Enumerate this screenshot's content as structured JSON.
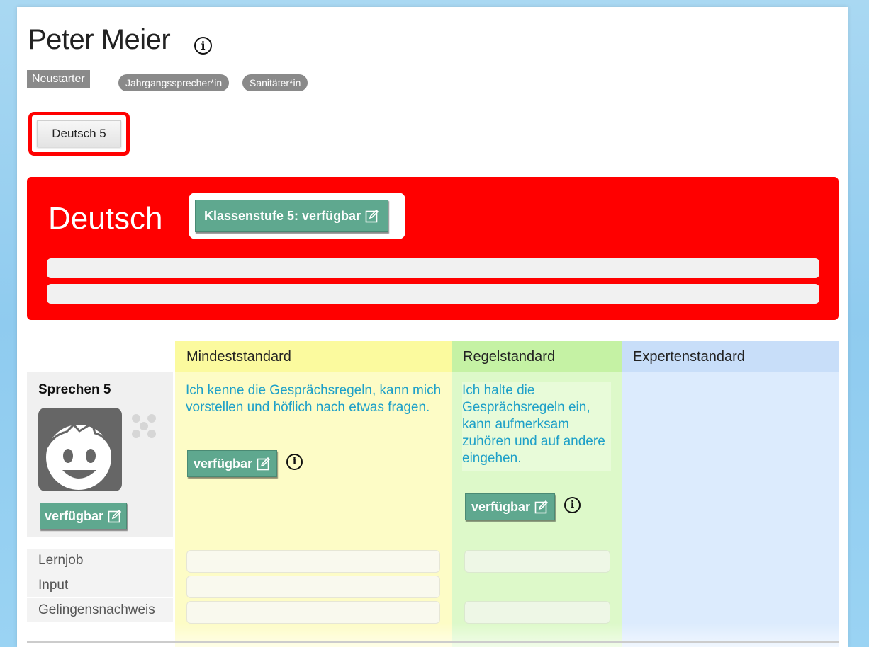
{
  "student": {
    "name": "Peter Meier",
    "status_badge": "Neustarter",
    "roles": [
      "Jahrgangssprecher*in",
      "Sanitäter*in"
    ]
  },
  "subject_tab": {
    "label": "Deutsch 5"
  },
  "subject_panel": {
    "title": "Deutsch",
    "level_button": "Klassenstufe 5: verfügbar",
    "color": "#ff0000"
  },
  "standards": {
    "headers": [
      "Mindeststandard",
      "Regelstandard",
      "Expertenstandard"
    ],
    "colors": {
      "min": "#fbfa9e",
      "regel": "#c5f2a4",
      "experten": "#c8def9"
    }
  },
  "competence": {
    "title": "Sprechen 5",
    "button": "verfügbar",
    "min_description": "Ich kenne die Gesprächsregeln, kann mich vorstellen und höflich nach etwas fragen.",
    "min_button": "verfügbar",
    "regel_description": "Ich halte die Gesprächsregeln ein, kann aufmerksam zuhören und auf andere eingehen.",
    "regel_button": "verfügbar"
  },
  "rows": {
    "labels": [
      "Lernjob",
      "Input",
      "Gelingensnachweis"
    ]
  },
  "icons": {
    "info": "info-icon",
    "edit": "edit-icon",
    "avatar": "smiley-avatar-icon",
    "dots": "dots-pattern-icon"
  }
}
